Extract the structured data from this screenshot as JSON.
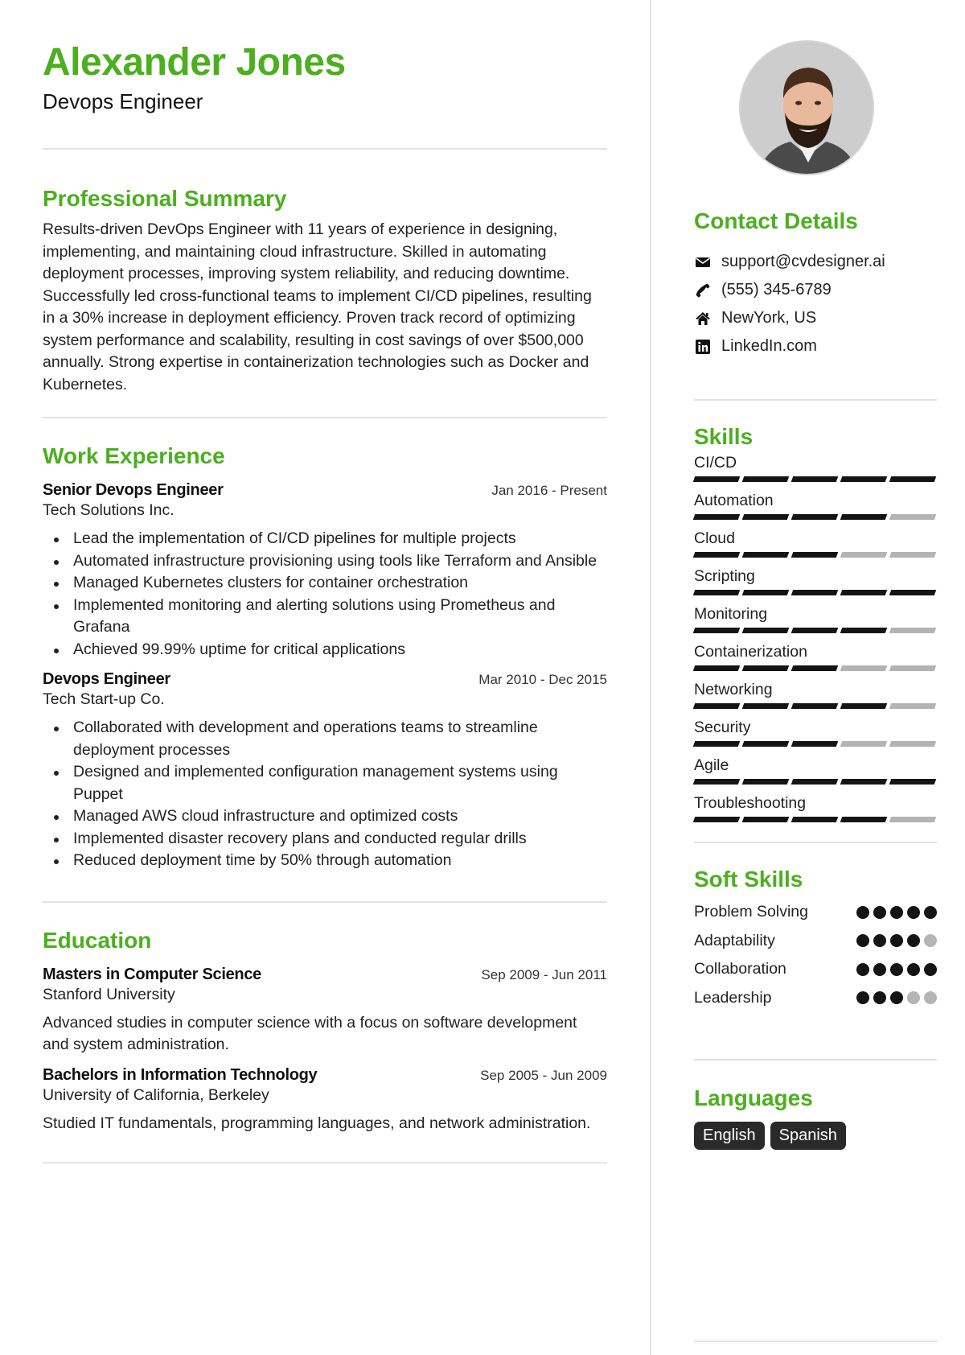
{
  "header": {
    "name": "Alexander Jones",
    "title": "Devops Engineer"
  },
  "summary": {
    "heading": "Professional Summary",
    "text": "Results-driven DevOps Engineer with 11 years of experience in designing, implementing, and maintaining cloud infrastructure. Skilled in automating deployment processes, improving system reliability, and reducing downtime. Successfully led cross-functional teams to implement CI/CD pipelines, resulting in a 30% increase in deployment efficiency. Proven track record of optimizing system performance and scalability, resulting in cost savings of over $500,000 annually. Strong expertise in containerization technologies such as Docker and Kubernetes."
  },
  "experience": {
    "heading": "Work Experience",
    "jobs": [
      {
        "title": "Senior Devops Engineer",
        "company": "Tech Solutions Inc.",
        "dates": "Jan 2016 - Present",
        "bullets": [
          "Lead the implementation of CI/CD pipelines for multiple projects",
          "Automated infrastructure provisioning using tools like Terraform and Ansible",
          "Managed Kubernetes clusters for container orchestration",
          "Implemented monitoring and alerting solutions using Prometheus and Grafana",
          "Achieved 99.99% uptime for critical applications"
        ]
      },
      {
        "title": "Devops Engineer",
        "company": "Tech Start-up Co.",
        "dates": "Mar 2010 - Dec 2015",
        "bullets": [
          "Collaborated with development and operations teams to streamline deployment processes",
          "Designed and implemented configuration management systems using Puppet",
          "Managed AWS cloud infrastructure and optimized costs",
          "Implemented disaster recovery plans and conducted regular drills",
          "Reduced deployment time by 50% through automation"
        ]
      }
    ]
  },
  "education": {
    "heading": "Education",
    "items": [
      {
        "degree": "Masters in Computer Science",
        "school": "Stanford University",
        "dates": "Sep 2009 - Jun 2011",
        "description": "Advanced studies in computer science with a focus on software development and system administration."
      },
      {
        "degree": "Bachelors in Information Technology",
        "school": "University of California, Berkeley",
        "dates": "Sep 2005 - Jun 2009",
        "description": "Studied IT fundamentals, programming languages, and network administration."
      }
    ]
  },
  "contact": {
    "heading": "Contact Details",
    "items": [
      {
        "icon": "envelope-icon",
        "text": "support@cvdesigner.ai"
      },
      {
        "icon": "phone-icon",
        "text": "(555) 345-6789"
      },
      {
        "icon": "home-icon",
        "text": "NewYork, US"
      },
      {
        "icon": "linkedin-icon",
        "text": "LinkedIn.com"
      }
    ]
  },
  "skills": {
    "heading": "Skills",
    "max": 5,
    "items": [
      {
        "name": "CI/CD",
        "level": 5
      },
      {
        "name": "Automation",
        "level": 4
      },
      {
        "name": "Cloud",
        "level": 3
      },
      {
        "name": "Scripting",
        "level": 5
      },
      {
        "name": "Monitoring",
        "level": 4
      },
      {
        "name": "Containerization",
        "level": 3
      },
      {
        "name": "Networking",
        "level": 4
      },
      {
        "name": "Security",
        "level": 3
      },
      {
        "name": "Agile",
        "level": 5
      },
      {
        "name": "Troubleshooting",
        "level": 4
      }
    ]
  },
  "soft_skills": {
    "heading": "Soft Skills",
    "max": 5,
    "items": [
      {
        "name": "Problem Solving",
        "level": 5
      },
      {
        "name": "Adaptability",
        "level": 4
      },
      {
        "name": "Collaboration",
        "level": 5
      },
      {
        "name": "Leadership",
        "level": 3
      }
    ]
  },
  "languages": {
    "heading": "Languages",
    "items": [
      "English",
      "Spanish"
    ]
  },
  "colors": {
    "accent": "#4caf1f",
    "filled": "#141414",
    "empty": "#b3b3b3",
    "tag_bg": "#2a2a2a"
  }
}
